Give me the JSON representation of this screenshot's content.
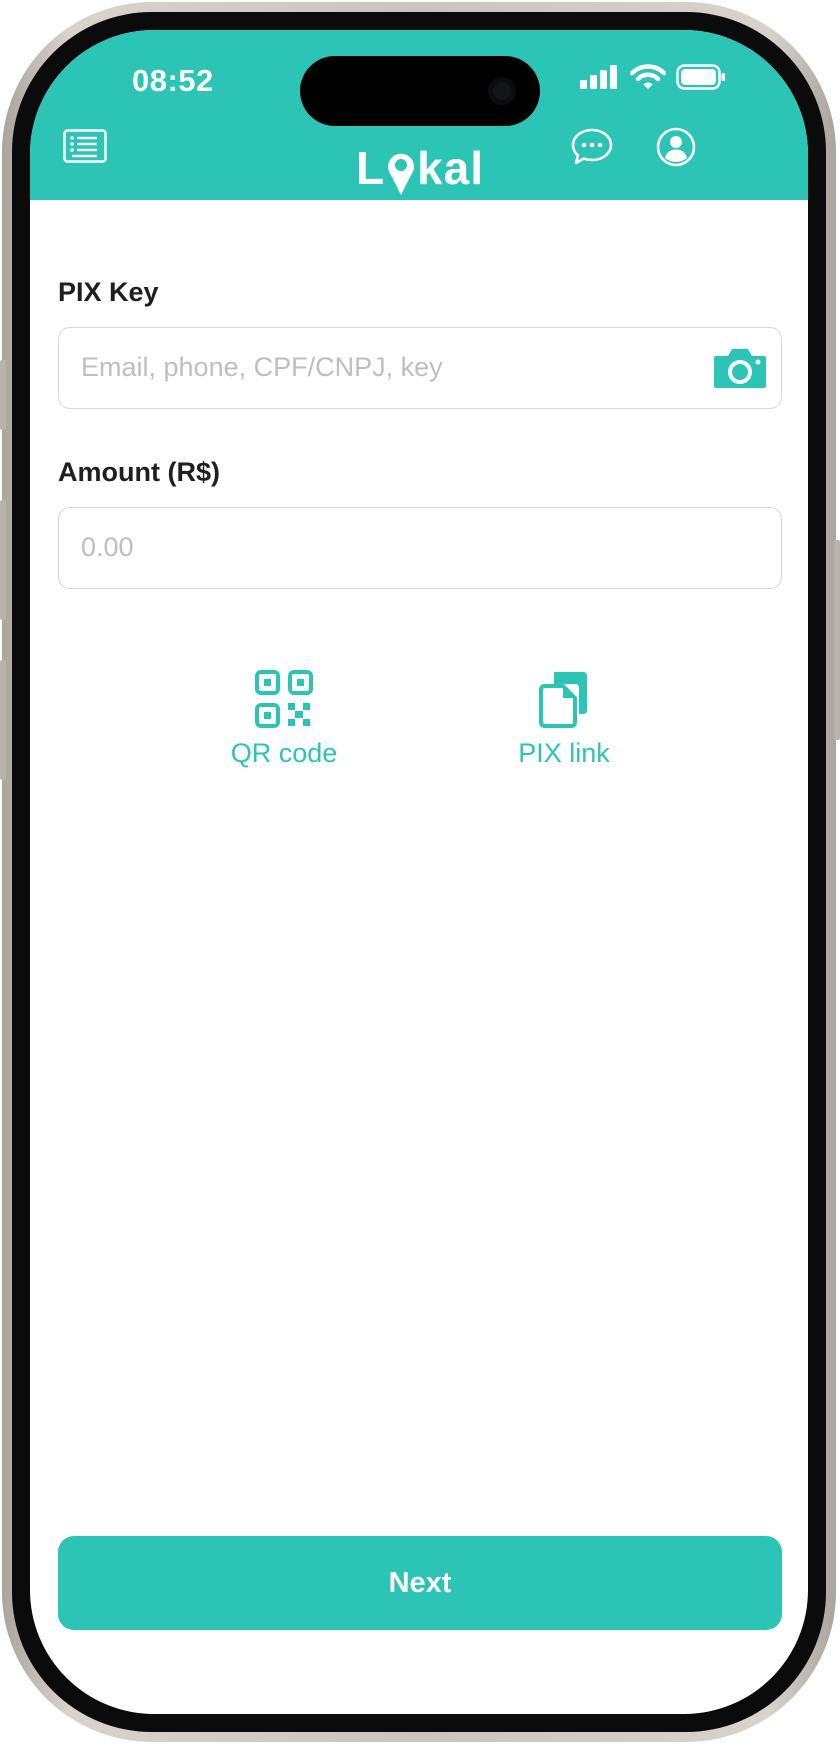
{
  "status_bar": {
    "time": "08:52"
  },
  "header": {
    "logo_prefix": "L",
    "logo_suffix": "kal",
    "menu_icon": "list-icon",
    "chat_icon": "chat-bubble-icon",
    "profile_icon": "user-circle-icon"
  },
  "pix_key": {
    "label": "PIX Key",
    "placeholder": "Email, phone, CPF/CNPJ, key",
    "value": "",
    "scan_icon": "camera-icon"
  },
  "amount": {
    "label": "Amount (R$)",
    "placeholder": "0.00",
    "value": ""
  },
  "actions": [
    {
      "label": "QR code",
      "icon": "qr-code-icon"
    },
    {
      "label": "PIX link",
      "icon": "copy-paste-icon"
    }
  ],
  "next_button": {
    "label": "Next"
  },
  "colors": {
    "brand": "#2cc5b5",
    "label": "#1f1f1f",
    "placeholder": "#bfbfbf",
    "border": "#d9d9d9"
  }
}
